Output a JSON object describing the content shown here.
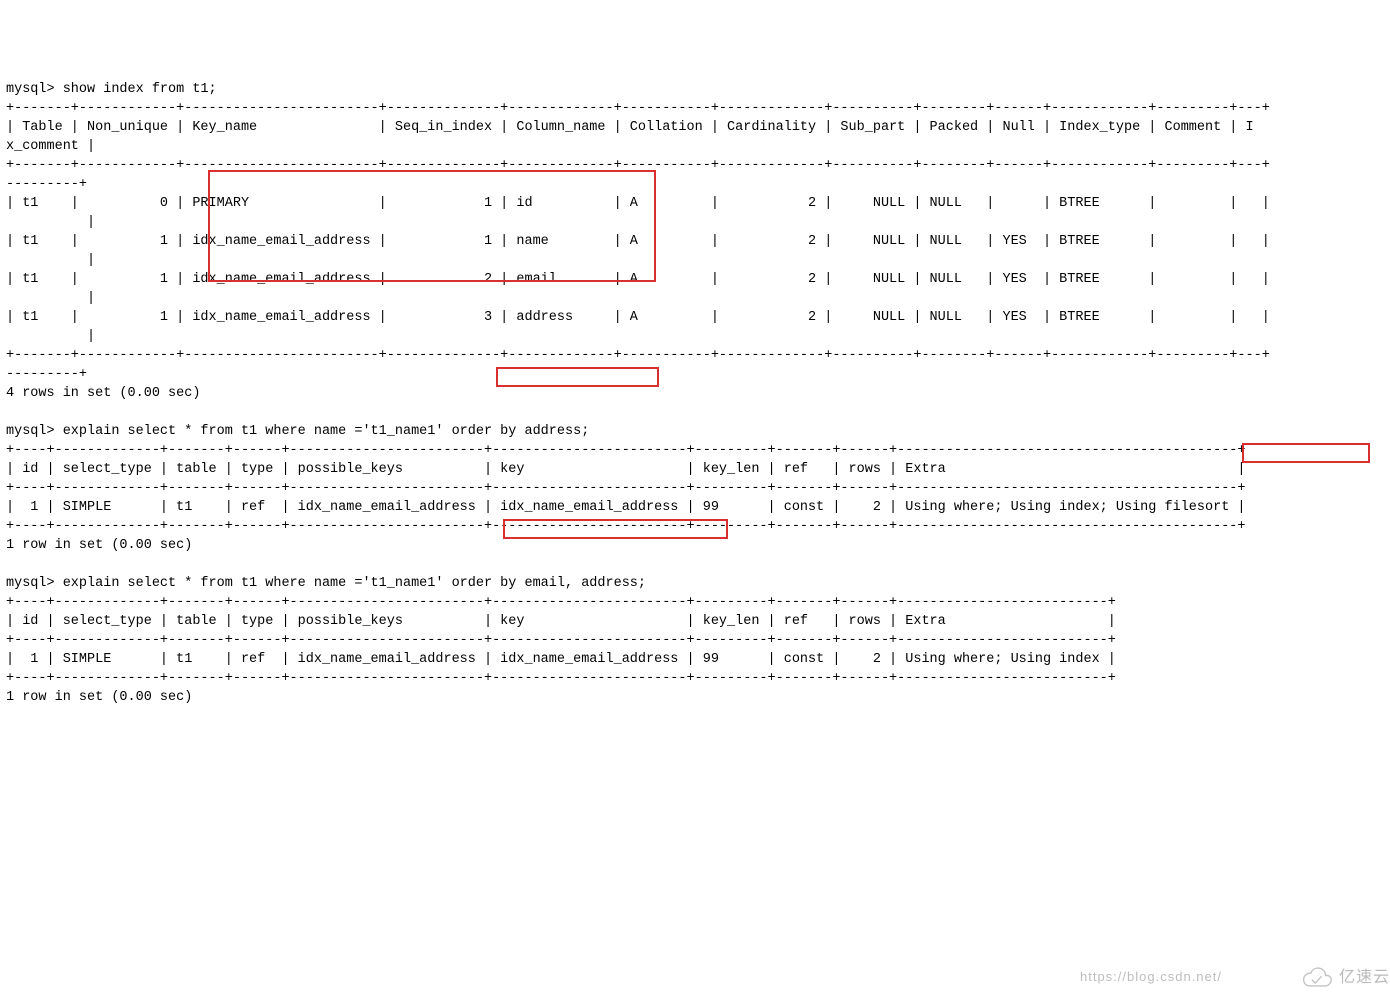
{
  "prompt": "mysql>",
  "commands": {
    "show_index": "show index from t1;",
    "explain1_pre": "explain select * from t1 where name ='t1_name1' ",
    "explain1_hl": "order by address;",
    "explain2_pre": "explain select * from t1 where name ='t1_name1' ",
    "explain2_hl": "order by email, address;"
  },
  "index_table": {
    "headers": [
      "Table",
      "Non_unique",
      "Key_name",
      "Seq_in_index",
      "Column_name",
      "Collation",
      "Cardinality",
      "Sub_part",
      "Packed",
      "Null",
      "Index_type",
      "Comment",
      "Index_comment"
    ],
    "rows": [
      {
        "Table": "t1",
        "Non_unique": "0",
        "Key_name": "PRIMARY",
        "Seq_in_index": "1",
        "Column_name": "id",
        "Collation": "A",
        "Cardinality": "2",
        "Sub_part": "NULL",
        "Packed": "NULL",
        "Null": "",
        "Index_type": "BTREE",
        "Comment": "",
        "Index_comment": ""
      },
      {
        "Table": "t1",
        "Non_unique": "1",
        "Key_name": "idx_name_email_address",
        "Seq_in_index": "1",
        "Column_name": "name",
        "Collation": "A",
        "Cardinality": "2",
        "Sub_part": "NULL",
        "Packed": "NULL",
        "Null": "YES",
        "Index_type": "BTREE",
        "Comment": "",
        "Index_comment": ""
      },
      {
        "Table": "t1",
        "Non_unique": "1",
        "Key_name": "idx_name_email_address",
        "Seq_in_index": "2",
        "Column_name": "email",
        "Collation": "A",
        "Cardinality": "2",
        "Sub_part": "NULL",
        "Packed": "NULL",
        "Null": "YES",
        "Index_type": "BTREE",
        "Comment": "",
        "Index_comment": ""
      },
      {
        "Table": "t1",
        "Non_unique": "1",
        "Key_name": "idx_name_email_address",
        "Seq_in_index": "3",
        "Column_name": "address",
        "Collation": "A",
        "Cardinality": "2",
        "Sub_part": "NULL",
        "Packed": "NULL",
        "Null": "YES",
        "Index_type": "BTREE",
        "Comment": "",
        "Index_comment": ""
      }
    ],
    "footer": "4 rows in set (0.00 sec)"
  },
  "explain1": {
    "headers": [
      "id",
      "select_type",
      "table",
      "type",
      "possible_keys",
      "key",
      "key_len",
      "ref",
      "rows",
      "Extra"
    ],
    "row": {
      "id": "1",
      "select_type": "SIMPLE",
      "table": "t1",
      "type": "ref",
      "possible_keys": "idx_name_email_address",
      "key": "idx_name_email_address",
      "key_len": "99",
      "ref": "const",
      "rows": "2",
      "Extra_pre": "Using where; Using index; ",
      "Extra_hl": "Using filesort"
    },
    "footer": "1 row in set (0.00 sec)"
  },
  "explain2": {
    "headers": [
      "id",
      "select_type",
      "table",
      "type",
      "possible_keys",
      "key",
      "key_len",
      "ref",
      "rows",
      "Extra"
    ],
    "row": {
      "id": "1",
      "select_type": "SIMPLE",
      "table": "t1",
      "type": "ref",
      "possible_keys": "idx_name_email_address",
      "key": "idx_name_email_address",
      "key_len": "99",
      "ref": "const",
      "rows": "2",
      "Extra": "Using where; Using index"
    },
    "footer": "1 row in set (0.00 sec)"
  },
  "watermark": {
    "text": "亿速云",
    "faint_url": "https://blog.csdn.net/"
  }
}
